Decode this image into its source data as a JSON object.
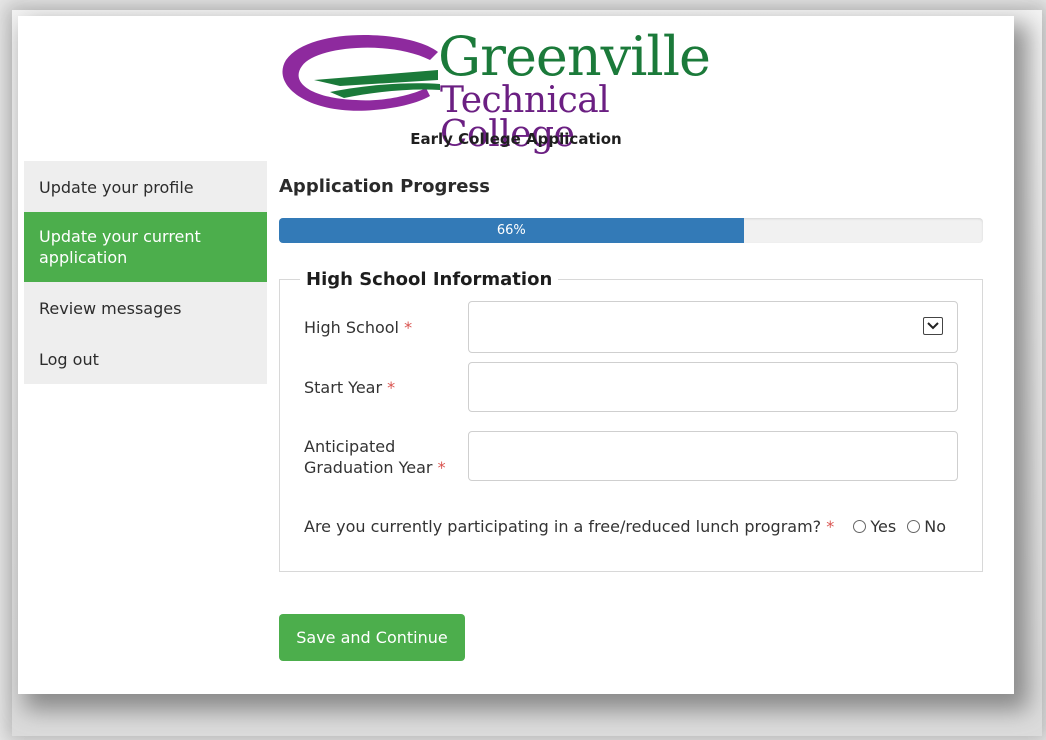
{
  "header": {
    "logo_line1": "Greenville",
    "logo_line2": "Technical College",
    "subtitle": "Early College Application"
  },
  "sidebar": {
    "items": [
      {
        "label": "Update your profile",
        "active": false
      },
      {
        "label": "Update your current application",
        "active": true
      },
      {
        "label": "Review messages",
        "active": false
      },
      {
        "label": "Log out",
        "active": false
      }
    ]
  },
  "progress": {
    "title": "Application Progress",
    "value": 66,
    "text": "66%"
  },
  "form": {
    "legend": "High School Information",
    "high_school_label": "High School",
    "high_school_value": "",
    "start_year_label": "Start Year",
    "start_year_value": "",
    "grad_year_label_line1": "Anticipated",
    "grad_year_label_line2": "Graduation Year",
    "grad_year_value": "",
    "lunch_question": "Are you currently participating in a free/reduced lunch program?",
    "required_marker": "*",
    "yes_label": "Yes",
    "no_label": "No"
  },
  "actions": {
    "save_label": "Save and Continue"
  },
  "colors": {
    "accent_green": "#4cae4c",
    "progress_blue": "#337ab7",
    "logo_green": "#1b7a3a",
    "logo_purple": "#6b1f82",
    "required_red": "#d9534f"
  }
}
